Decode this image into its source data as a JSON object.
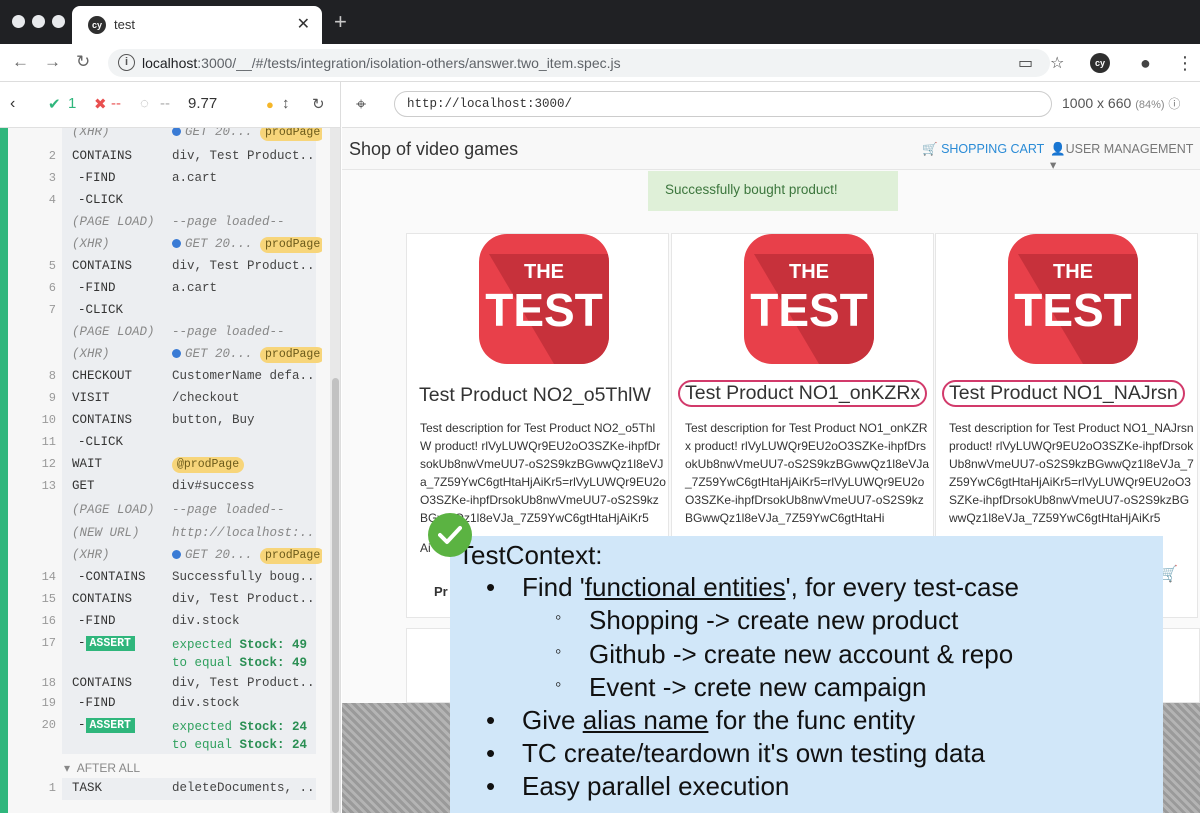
{
  "browser": {
    "tab_title": "test",
    "favicon": "cy",
    "url_host": "localhost",
    "url_path": ":3000/__/#/tests/integration/isolation-others/answer.two_item.spec.js"
  },
  "reporter": {
    "passed": "1",
    "failed": "--",
    "pending": "--",
    "duration": "9.77",
    "commands": [
      {
        "num": "",
        "name": "(XHR)",
        "msg": "GET 20...",
        "alias": "prodPage",
        "dim": true,
        "xhr": true
      },
      {
        "num": "2",
        "name": "CONTAINS",
        "msg": "div, Test Product..."
      },
      {
        "num": "3",
        "name": "-FIND",
        "msg": "a.cart",
        "sub": true
      },
      {
        "num": "4",
        "name": "-CLICK",
        "msg": "",
        "sub": true
      },
      {
        "num": "",
        "name": "(PAGE LOAD)",
        "msg": "--page loaded--",
        "dim": true
      },
      {
        "num": "",
        "name": "(XHR)",
        "msg": "GET 20...",
        "alias": "prodPage",
        "dim": true,
        "xhr": true
      },
      {
        "num": "5",
        "name": "CONTAINS",
        "msg": "div, Test Product..."
      },
      {
        "num": "6",
        "name": "-FIND",
        "msg": "a.cart",
        "sub": true
      },
      {
        "num": "7",
        "name": "-CLICK",
        "msg": "",
        "sub": true
      },
      {
        "num": "",
        "name": "(PAGE LOAD)",
        "msg": "--page loaded--",
        "dim": true
      },
      {
        "num": "",
        "name": "(XHR)",
        "msg": "GET 20...",
        "alias": "prodPage",
        "dim": true,
        "xhr": true
      },
      {
        "num": "8",
        "name": "CHECKOUT",
        "msg": "CustomerName defa..."
      },
      {
        "num": "9",
        "name": "VISIT",
        "msg": "/checkout"
      },
      {
        "num": "10",
        "name": "CONTAINS",
        "msg": "button, Buy"
      },
      {
        "num": "11",
        "name": "-CLICK",
        "msg": "",
        "sub": true
      },
      {
        "num": "12",
        "name": "WAIT",
        "msg": "",
        "alias": "@prodPage"
      },
      {
        "num": "13",
        "name": "GET",
        "msg": "div#success"
      },
      {
        "num": "",
        "name": "(PAGE LOAD)",
        "msg": "--page loaded--",
        "dim": true
      },
      {
        "num": "",
        "name": "(NEW URL)",
        "msg": "http://localhost:...",
        "dim": true
      },
      {
        "num": "",
        "name": "(XHR)",
        "msg": "GET 20...",
        "alias": "prodPage",
        "dim": true,
        "xhr": true
      },
      {
        "num": "14",
        "name": "-CONTAINS",
        "msg": "Successfully boug...",
        "sub": true
      },
      {
        "num": "15",
        "name": "CONTAINS",
        "msg": "div, Test Product..."
      },
      {
        "num": "16",
        "name": "-FIND",
        "msg": "div.stock",
        "sub": true
      },
      {
        "num": "17",
        "name": "-ASSERT",
        "assert": true,
        "exp1": "expected",
        "val1": "Stock: 49",
        "exp2": "to equal",
        "val2": "Stock: 49"
      },
      {
        "num": "18",
        "name": "CONTAINS",
        "msg": "div, Test Product..."
      },
      {
        "num": "19",
        "name": "-FIND",
        "msg": "div.stock",
        "sub": true
      },
      {
        "num": "20",
        "name": "-ASSERT",
        "assert": true,
        "exp1": "expected",
        "val1": "Stock: 24",
        "exp2": "to equal",
        "val2": "Stock: 24"
      }
    ],
    "after_all_label": "AFTER ALL",
    "after_all_cmd": {
      "num": "1",
      "name": "TASK",
      "msg": "deleteDocuments, ..."
    }
  },
  "app": {
    "url": "http://localhost:3000/",
    "size": "1000 x 660",
    "scale": "(84%)",
    "shop_title": "Shop of video games",
    "cart_link": "SHOPPING CART",
    "user_link": "USER MANAGEMENT",
    "success_msg": "Successfully bought product!",
    "logo_line1": "THE",
    "logo_line2": "TEST",
    "products": [
      {
        "name": "Test Product NO2_o5ThlW",
        "desc": "Test description for Test Product NO2_o5ThlW product! rlVyLUWQr9EU2oO3SZKe-ihpfDrsokUb8nwVmeUU7-oS2S9kzBGwwQz1l8eVJa_7Z59YwC6gtHtaHjAiKr5=rlVyLUWQr9EU2oO3SZKe-ihpfDrsokUb8nwVmeUU7-oS2S9kzBGwwQz1l8eVJa_7Z59YwC6gtHtaHjAiKr5",
        "ring": false
      },
      {
        "name": "Test Product NO1_onKZRx",
        "desc": "Test description for Test Product NO1_onKZRx product! rlVyLUWQr9EU2oO3SZKe-ihpfDrsokUb8nwVmeUU7-oS2S9kzBGwwQz1l8eVJa_7Z59YwC6gtHtaHjAiKr5=rlVyLUWQr9EU2oO3SZKe-ihpfDrsokUb8nwVmeUU7-oS2S9kzBGwwQz1l8eVJa_7Z59YwC6gtHtaHi",
        "ring": true
      },
      {
        "name": "Test Product NO1_NAJrsn",
        "desc": "Test description for Test Product NO1_NAJrsn product! rlVyLUWQr9EU2oO3SZKe-ihpfDrsokUb8nwVmeUU7-oS2S9kzBGwwQz1l8eVJa_7Z59YwC6gtHtaHjAiKr5=rlVyLUWQr9EU2oO3SZKe-ihpfDrsokUb8nwVmeUU7-oS2S9kzBGwwQz1l8eVJa_7Z59YwC6gtHtaHjAiKr5",
        "ring": true
      }
    ],
    "partial_text": "Ai",
    "partial_text2": "Pr"
  },
  "slide": {
    "title": "TestContext:",
    "b1_pre": "Find '",
    "b1_u": "functional entities",
    "b1_post": "', for every test-case",
    "c1": "Shopping -> create new product",
    "c2": "Github -> create new account & repo",
    "c3": "Event -> crete new campaign",
    "b2_pre": "Give ",
    "b2_u": "alias name",
    "b2_post": " for the func entity",
    "b3": "TC create/teardown it's own testing data",
    "b4": "Easy parallel execution"
  },
  "colors": {
    "pass": "#2fb67c",
    "fail": "#e94f4f",
    "alias": "#f7d57a",
    "ring": "#d23a6b",
    "slide_bg": "#d1e7f9"
  }
}
